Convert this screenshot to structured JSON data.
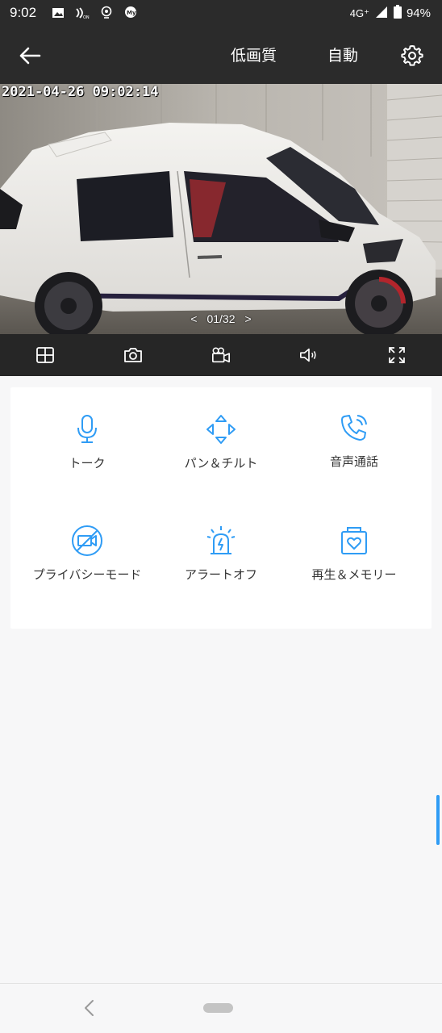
{
  "status_bar": {
    "time": "9:02",
    "network": "4G⁺",
    "battery": "94%",
    "left_icons": [
      "image-icon",
      "nfc-icon",
      "location-icon",
      "mydocomo-icon"
    ]
  },
  "header": {
    "quality_label": "低画質",
    "auto_label": "自動"
  },
  "video": {
    "timestamp": "2021-04-26 09:02:14",
    "pager_prev": "<",
    "pager_text": "01/32",
    "pager_next": ">"
  },
  "video_toolbar": {
    "items": [
      "grid-view-icon",
      "snapshot-camera-icon",
      "record-video-icon",
      "speaker-volume-icon",
      "fullscreen-expand-icon"
    ]
  },
  "controls": [
    {
      "label": "トーク",
      "icon": "microphone-icon"
    },
    {
      "label": "パン＆チルト",
      "icon": "pan-tilt-arrows-icon"
    },
    {
      "label": "音声通話",
      "icon": "phone-call-icon"
    },
    {
      "label": "プライバシーモード",
      "icon": "privacy-camera-off-icon"
    },
    {
      "label": "アラートオフ",
      "icon": "alarm-light-icon"
    },
    {
      "label": "再生＆メモリー",
      "icon": "playback-memory-icon"
    }
  ],
  "colors": {
    "accent": "#2f9cf5",
    "appbar_bg": "#2b2b2b",
    "toolbar_bg": "#262626",
    "page_bg": "#f7f7f8"
  }
}
